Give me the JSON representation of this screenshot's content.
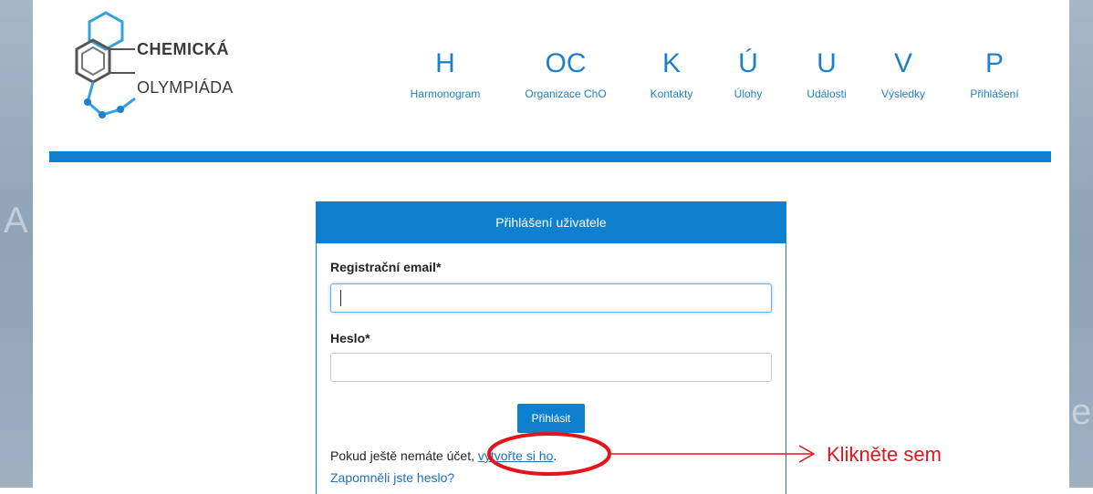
{
  "logo": {
    "line1": "CHEMICKÁ",
    "line2": "OLYMPIÁDA"
  },
  "nav": [
    {
      "letter": "H",
      "label": "Harmonogram"
    },
    {
      "letter": "OC",
      "label": "Organizace ChO"
    },
    {
      "letter": "K",
      "label": "Kontakty"
    },
    {
      "letter": "Ú",
      "label": "Úlohy"
    },
    {
      "letter": "U",
      "label": "Události"
    },
    {
      "letter": "V",
      "label": "Výsledky"
    },
    {
      "letter": "P",
      "label": "Přihlášení"
    }
  ],
  "login": {
    "title": "Přihlášení uživatele",
    "email_label": "Registrační email*",
    "email_value": "",
    "password_label": "Heslo*",
    "password_value": "",
    "submit_label": "Přihlásit",
    "signup_prefix": "Pokud ještě nemáte účet, ",
    "signup_link": "vytvořte si ho",
    "signup_suffix": ".",
    "forgot_link": "Zapomněli jste heslo?"
  },
  "annotation": {
    "text": "Klikněte sem",
    "color": "#e3141b"
  },
  "colors": {
    "accent": "#0f7fd0",
    "link": "#1f6fb5"
  }
}
